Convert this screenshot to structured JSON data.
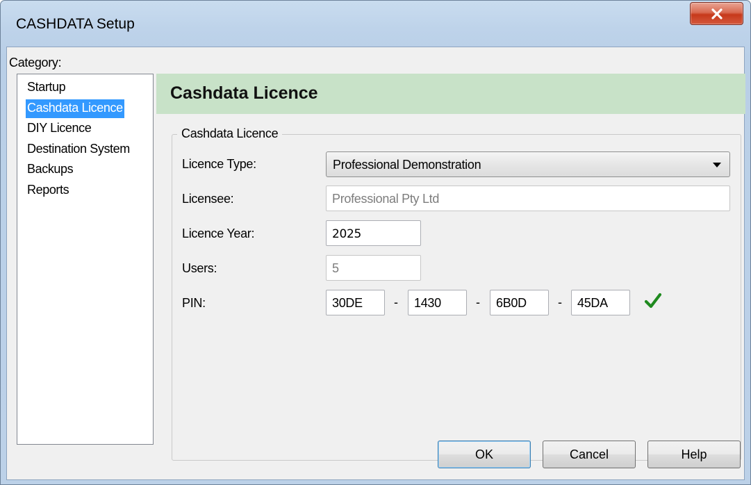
{
  "window": {
    "title": "CASHDATA Setup",
    "close_icon": "close-icon"
  },
  "category": {
    "label": "Category:",
    "items": [
      {
        "label": "Startup"
      },
      {
        "label": "Cashdata Licence",
        "selected": true
      },
      {
        "label": "DIY Licence"
      },
      {
        "label": "Destination System"
      },
      {
        "label": "Backups"
      },
      {
        "label": "Reports"
      }
    ]
  },
  "panel": {
    "title": "Cashdata Licence",
    "group_title": "Cashdata Licence",
    "header_color": "#c8e2c8"
  },
  "fields": {
    "licence_type": {
      "label": "Licence Type:",
      "value": "Professional Demonstration"
    },
    "licensee": {
      "label": "Licensee:",
      "value": "Professional Pty Ltd"
    },
    "licence_year": {
      "label": "Licence Year:",
      "value": "2025"
    },
    "users": {
      "label": "Users:",
      "value": "5"
    },
    "pin": {
      "label": "PIN:",
      "parts": [
        "30DE",
        "1430",
        "6B0D",
        "45DA"
      ],
      "separator": "-",
      "valid_icon": "checkmark-icon"
    }
  },
  "buttons": {
    "ok": "OK",
    "cancel": "Cancel",
    "help": "Help"
  }
}
